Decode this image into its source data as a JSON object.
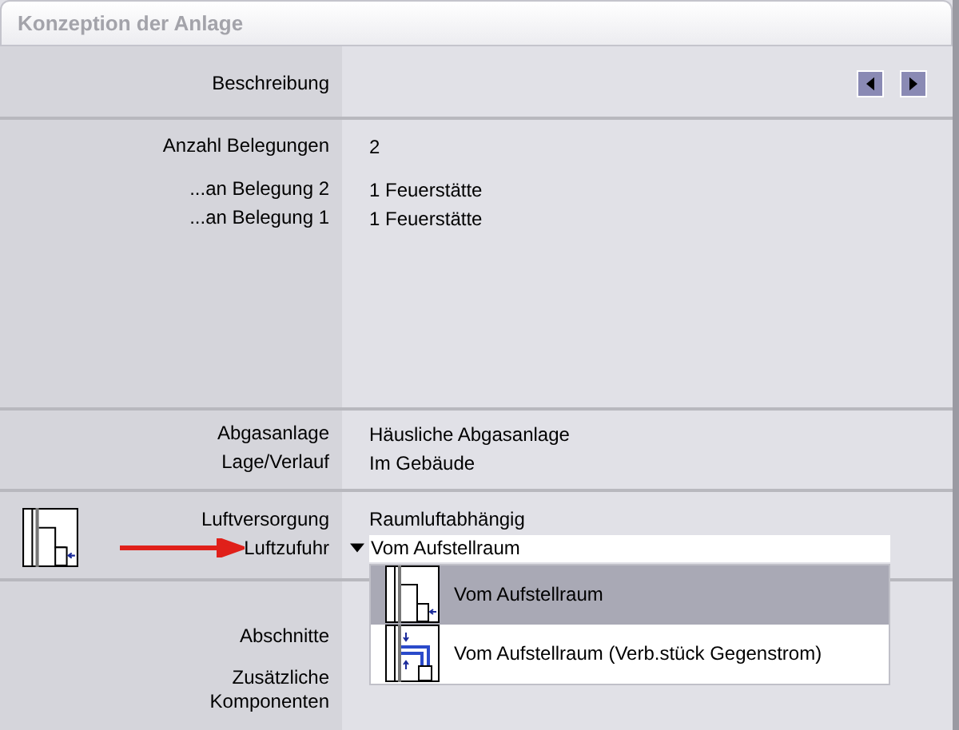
{
  "title": "Konzeption der Anlage",
  "sections": [
    {
      "controls": [
        {
          "kind": "prev"
        },
        {
          "kind": "next"
        }
      ],
      "rows": [
        {
          "label": "Beschreibung"
        }
      ]
    },
    {
      "rows": [
        {
          "label": "Anzahl Belegungen",
          "value": "2"
        },
        {
          "label": "...an Belegung 2",
          "value": "1 Feuerstätte"
        },
        {
          "label": "...an Belegung 1",
          "value": "1 Feuerstätte"
        }
      ]
    },
    {
      "rows": [
        {
          "label": "Abgasanlage",
          "value": "Häusliche Abgasanlage"
        },
        {
          "label": "Lage/Verlauf",
          "value": "Im Gebäude"
        }
      ]
    },
    {
      "icon": {
        "kind": "room-air"
      },
      "rows": [
        {
          "label": "Luftversorgung",
          "value": "Raumluftabhängig"
        },
        {
          "label": "Luftzufuhr",
          "kind": "dropdown",
          "pointer_arrow": true,
          "value": "Vom Aufstellraum",
          "expanded": true,
          "options": [
            {
              "label": "Vom Aufstellraum",
              "kind": "room-air",
              "selected": true
            },
            {
              "label": "Vom Aufstellraum (Verb.stück Gegenstrom)",
              "kind": "counterflow",
              "selected": false
            }
          ]
        }
      ]
    },
    {
      "rows": [
        {
          "label": "Abschnitte"
        },
        {
          "label": "Zusätzliche Komponenten"
        }
      ]
    }
  ]
}
